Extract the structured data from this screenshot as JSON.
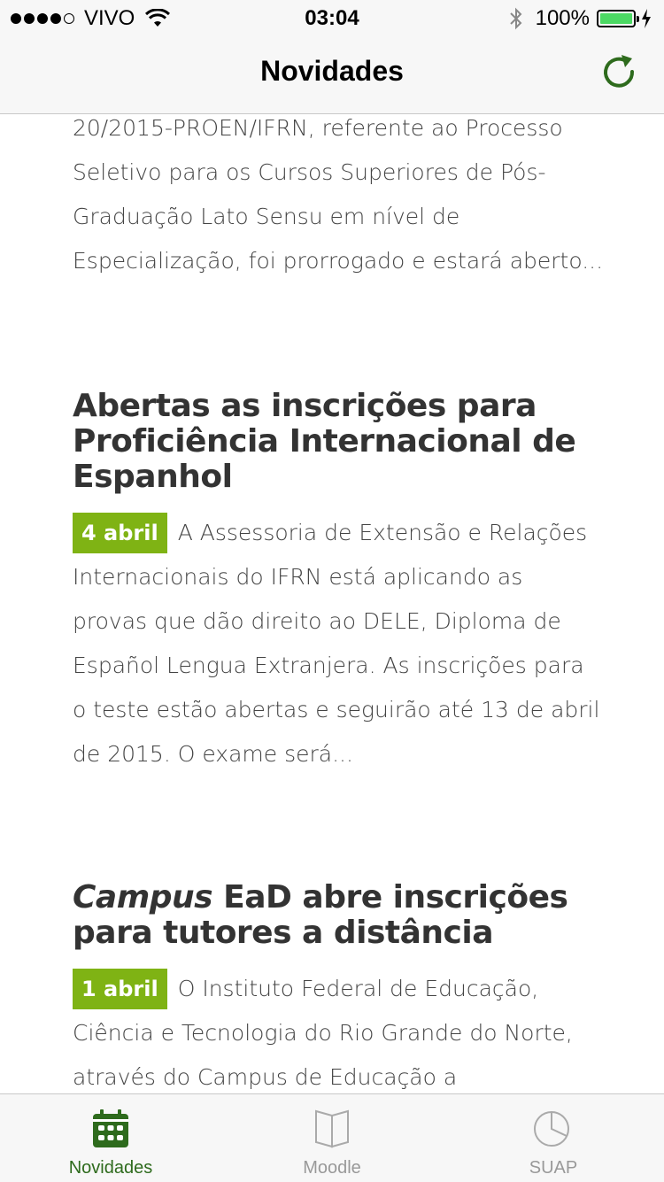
{
  "status_bar": {
    "carrier": "VIVO",
    "time": "03:04",
    "battery": "100%",
    "signal_bars": 4,
    "battery_level": 1.0
  },
  "nav": {
    "title": "Novidades",
    "refresh_icon": "refresh-icon"
  },
  "articles": [
    {
      "text": "20/2015-PROEN/IFRN, referente ao Processo Seletivo para os Cursos Superiores de Pós-Graduação Lato Sensu em nível de Especialização, foi prorrogado e estará aberto..."
    },
    {
      "title": "Abertas as inscrições para Proficiência Internacional de Espanhol",
      "date": "4 abril",
      "text": "A Assessoria de Extensão e Relações Internacionais do IFRN está aplicando as provas que dão direito ao DELE, Diploma de Español Lengua Extranjera. As inscrições para o teste estão abertas e seguirão até 13 de abril de 2015. O exame será..."
    },
    {
      "title_italic": "Campus",
      "title": " EaD abre inscrições para tutores a distância",
      "date": "1 abril",
      "text": "O Instituto Federal de Educação, Ciência e Tecnologia do Rio Grande do Norte, através do Campus de Educação a"
    }
  ],
  "tabs": [
    {
      "label": "Novidades",
      "icon": "calendar-icon",
      "active": true
    },
    {
      "label": "Moodle",
      "icon": "book-icon",
      "active": false
    },
    {
      "label": "SUAP",
      "icon": "pie-chart-icon",
      "active": false
    }
  ],
  "colors": {
    "accent_green": "#7fb314",
    "dark_green": "#2e6b1d",
    "battery_green": "#4cd964"
  }
}
